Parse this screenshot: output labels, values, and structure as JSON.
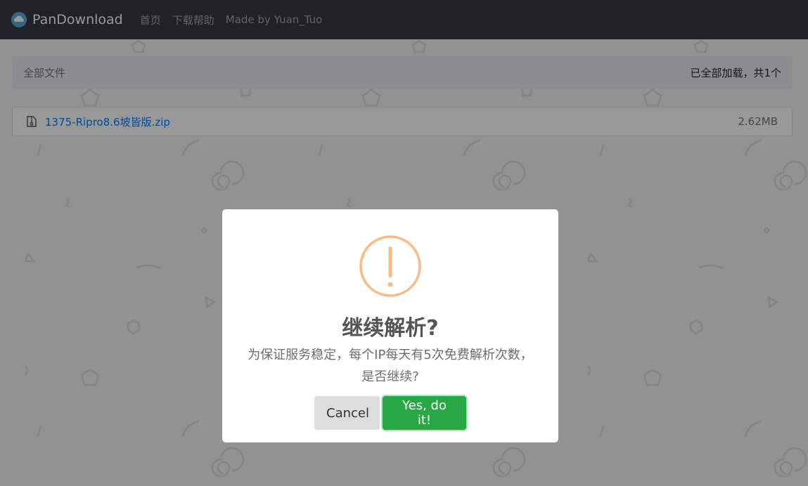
{
  "navbar": {
    "brand": "PanDownload",
    "links": [
      "首页",
      "下载帮助",
      "Made by Yuan_Tuo"
    ]
  },
  "breadcrumb": {
    "path": "全部文件",
    "status": "已全部加载，共1个"
  },
  "files": [
    {
      "name": "1375-Ripro8.6坡皆版.zip",
      "size": "2.62MB",
      "icon": "zip-file-icon"
    }
  ],
  "modal": {
    "icon": "warning-icon",
    "title": "继续解析?",
    "text": "为保证服务稳定，每个IP每天有5次免费解析次数，是否继续?",
    "cancel_label": "Cancel",
    "confirm_label": "Yes, do it!"
  },
  "colors": {
    "navbar": "#343a40",
    "warning": "#f8bb86",
    "confirm": "#28a745",
    "link": "#007bff"
  }
}
